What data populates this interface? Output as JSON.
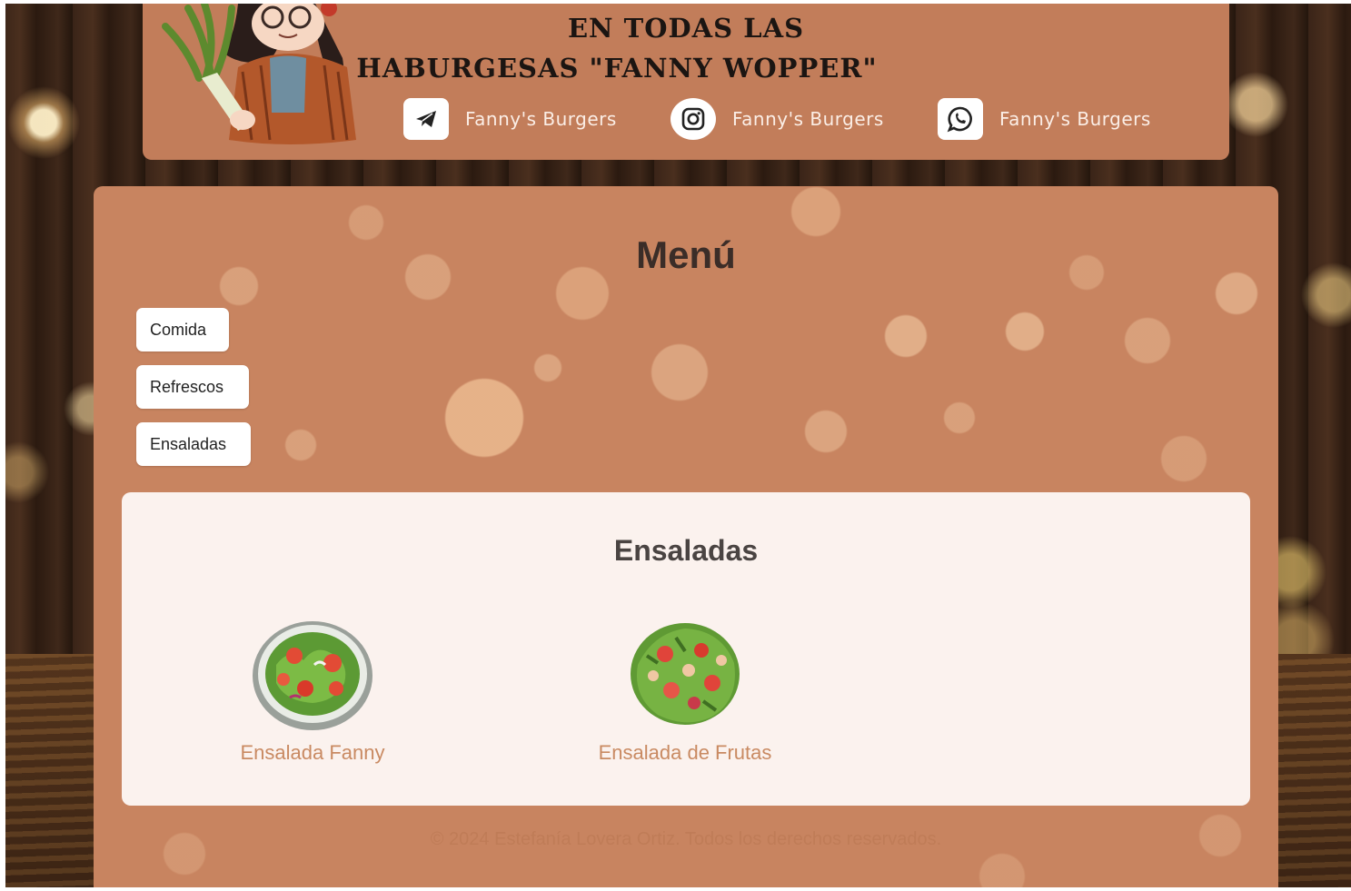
{
  "header": {
    "promo_line1": "EN TODAS LAS",
    "promo_line2": "HABURGESAS \"FANNY WOPPER\"",
    "social": [
      {
        "icon": "telegram-icon",
        "label": "Fanny's Burgers"
      },
      {
        "icon": "instagram-icon",
        "label": "Fanny's Burgers"
      },
      {
        "icon": "whatsapp-icon",
        "label": "Fanny's Burgers"
      }
    ]
  },
  "menu": {
    "title": "Menú",
    "categories": [
      "Comida",
      "Refrescos",
      "Ensaladas"
    ]
  },
  "section": {
    "title": "Ensaladas",
    "items": [
      {
        "name": "Ensalada Fanny"
      },
      {
        "name": "Ensalada de Frutas"
      }
    ]
  },
  "footer": {
    "text": "© 2024 Estefanía Lovera Ortiz. Todos los derechos reservados."
  },
  "colors": {
    "header_bg": "#c27d5a",
    "panel_bg": "#c88460",
    "card_bg": "#fbf2ee",
    "item_text": "#c98a62"
  }
}
